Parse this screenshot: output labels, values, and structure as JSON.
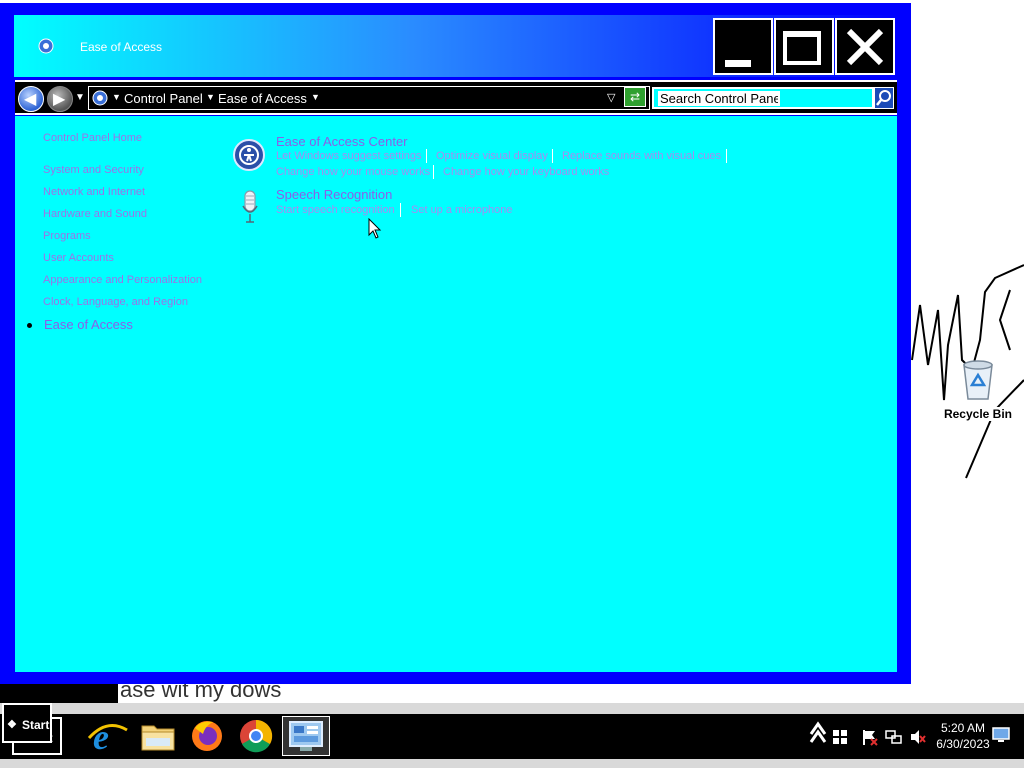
{
  "window": {
    "title": "Ease of Access",
    "minimize_label": "Minimize",
    "maximize_label": "Maximize",
    "close_label": "Close"
  },
  "addressbar": {
    "breadcrumbs": [
      "Control Panel",
      "Ease of Access"
    ],
    "search_placeholder": "Search Control Panel"
  },
  "sidebar": {
    "home": "Control Panel Home",
    "items": [
      "System and Security",
      "Network and Internet",
      "Hardware and Sound",
      "Programs",
      "User Accounts",
      "Appearance and Personalization",
      "Clock, Language, and Region",
      "Ease of Access"
    ]
  },
  "categories": [
    {
      "title": "Ease of Access Center",
      "icon": "ease-of-access-icon",
      "links": [
        "Let Windows suggest settings",
        "Optimize visual display",
        "Replace sounds with visual cues",
        "Change how your mouse works",
        "Change how your keyboard works"
      ]
    },
    {
      "title": "Speech Recognition",
      "icon": "microphone-icon",
      "links": [
        "Start speech recognition",
        "Set up a microphone"
      ]
    }
  ],
  "desktop": {
    "recycle_bin_label": "Recycle Bin",
    "background_caption": "ase wit my dows"
  },
  "taskbar": {
    "start_label": "Start",
    "ghost_start_label": "rt",
    "apps": [
      "internet-explorer-icon",
      "file-explorer-icon",
      "firefox-icon",
      "chrome-icon",
      "control-panel-icon"
    ],
    "time": "5:20 AM",
    "date": "6/30/2023"
  },
  "colors": {
    "window_frame": "#0000ff",
    "content_bg": "#00ffff",
    "link": "#9b73e6"
  }
}
